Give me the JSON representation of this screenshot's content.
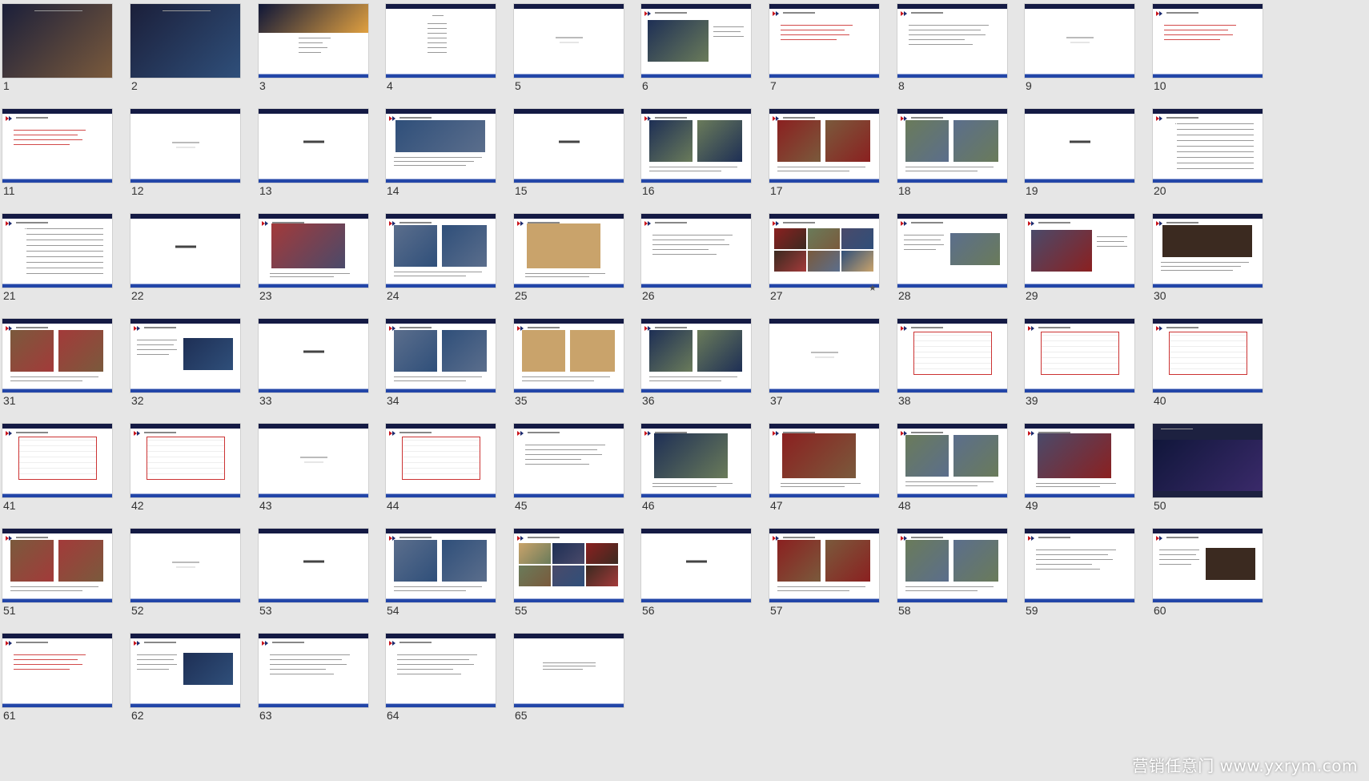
{
  "slides": [
    {
      "n": "1"
    },
    {
      "n": "2"
    },
    {
      "n": "3"
    },
    {
      "n": "4"
    },
    {
      "n": "5"
    },
    {
      "n": "6"
    },
    {
      "n": "7"
    },
    {
      "n": "8"
    },
    {
      "n": "9"
    },
    {
      "n": "10"
    },
    {
      "n": "11"
    },
    {
      "n": "12"
    },
    {
      "n": "13"
    },
    {
      "n": "14"
    },
    {
      "n": "15"
    },
    {
      "n": "16"
    },
    {
      "n": "17"
    },
    {
      "n": "18"
    },
    {
      "n": "19"
    },
    {
      "n": "20"
    },
    {
      "n": "21"
    },
    {
      "n": "22"
    },
    {
      "n": "23"
    },
    {
      "n": "24"
    },
    {
      "n": "25"
    },
    {
      "n": "26"
    },
    {
      "n": "27"
    },
    {
      "n": "28"
    },
    {
      "n": "29"
    },
    {
      "n": "30"
    },
    {
      "n": "31"
    },
    {
      "n": "32"
    },
    {
      "n": "33"
    },
    {
      "n": "34"
    },
    {
      "n": "35"
    },
    {
      "n": "36"
    },
    {
      "n": "37"
    },
    {
      "n": "38"
    },
    {
      "n": "39"
    },
    {
      "n": "40"
    },
    {
      "n": "41"
    },
    {
      "n": "42"
    },
    {
      "n": "43"
    },
    {
      "n": "44"
    },
    {
      "n": "45"
    },
    {
      "n": "46"
    },
    {
      "n": "47"
    },
    {
      "n": "48"
    },
    {
      "n": "49"
    },
    {
      "n": "50"
    },
    {
      "n": "51"
    },
    {
      "n": "52"
    },
    {
      "n": "53"
    },
    {
      "n": "54"
    },
    {
      "n": "55"
    },
    {
      "n": "56"
    },
    {
      "n": "57"
    },
    {
      "n": "58"
    },
    {
      "n": "59"
    },
    {
      "n": "60"
    },
    {
      "n": "61"
    },
    {
      "n": "62"
    },
    {
      "n": "63"
    },
    {
      "n": "64"
    },
    {
      "n": "65"
    }
  ],
  "animation_marker": "★",
  "watermark": "营销任意门 www.yxrym.com",
  "colors": {
    "bg": "#e6e6e6",
    "top_bar": "#141a44",
    "bottom_bar": "#2346a8",
    "accent_red": "#c8161d"
  }
}
